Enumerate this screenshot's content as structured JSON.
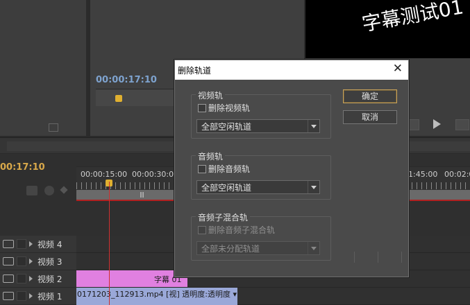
{
  "source_monitor": {
    "timecode": "00:00:17:10"
  },
  "program_monitor": {
    "caption_text": "字幕测试01"
  },
  "timeline": {
    "timecode": "00:17:10",
    "ruler_labels": [
      "00:00:15:00",
      "00:00:30:00",
      "1:45:00",
      "00:02:0"
    ],
    "tracks": [
      {
        "name": "视频 4"
      },
      {
        "name": "视频 3"
      },
      {
        "name": "视频 2"
      },
      {
        "name": "视频 1"
      }
    ],
    "clips": {
      "title_clip": "字幕 01",
      "video_clip": "0171203_112913.mp4 [视] 透明度:透明度 ▾"
    }
  },
  "dialog": {
    "title": "删除轨道",
    "close_glyph": "✕",
    "video_group": {
      "legend": "视频轨",
      "checkbox_label": "删除视频轨",
      "select_value": "全部空闲轨道"
    },
    "audio_group": {
      "legend": "音频轨",
      "checkbox_label": "删除音频轨",
      "select_value": "全部空闲轨道"
    },
    "submix_group": {
      "legend": "音频子混合轨",
      "checkbox_label": "删除音频子混合轨",
      "select_value": "全部未分配轨道"
    },
    "ok_label": "确定",
    "cancel_label": "取消"
  }
}
